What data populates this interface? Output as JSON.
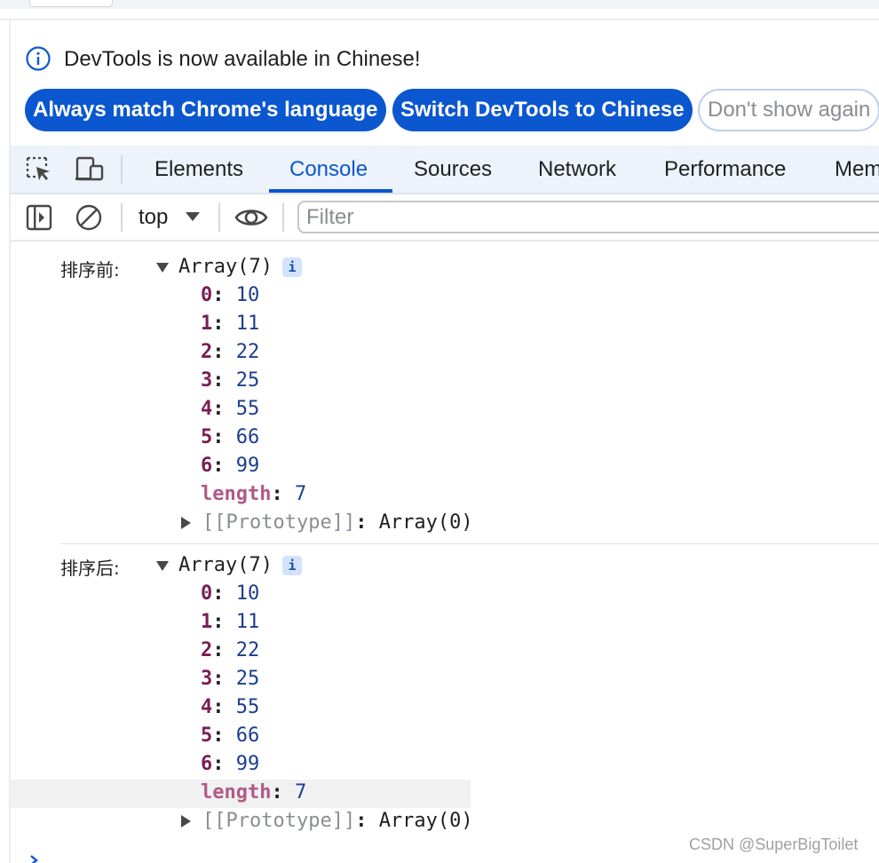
{
  "infobar": {
    "message": "DevTools is now available in Chinese!",
    "buttons": [
      "Always match Chrome's language",
      "Switch DevTools to Chinese",
      "Don't show again"
    ]
  },
  "tabs": [
    "Elements",
    "Console",
    "Sources",
    "Network",
    "Performance",
    "Mem"
  ],
  "active_tab": "Console",
  "console_toolbar": {
    "context": "top",
    "filter_placeholder": "Filter"
  },
  "messages": [
    {
      "label": "排序前:",
      "header": "Array(7)",
      "info_badge": "i",
      "entries": [
        {
          "key": "0",
          "value": "10"
        },
        {
          "key": "1",
          "value": "11"
        },
        {
          "key": "2",
          "value": "22"
        },
        {
          "key": "3",
          "value": "25"
        },
        {
          "key": "4",
          "value": "55"
        },
        {
          "key": "5",
          "value": "66"
        },
        {
          "key": "6",
          "value": "99"
        }
      ],
      "length_key": "length",
      "length_value": "7",
      "prototype_key": "[[Prototype]]",
      "prototype_value": "Array(0)"
    },
    {
      "label": "排序后:",
      "header": "Array(7)",
      "info_badge": "i",
      "entries": [
        {
          "key": "0",
          "value": "10"
        },
        {
          "key": "1",
          "value": "11"
        },
        {
          "key": "2",
          "value": "22"
        },
        {
          "key": "3",
          "value": "25"
        },
        {
          "key": "4",
          "value": "55"
        },
        {
          "key": "5",
          "value": "66"
        },
        {
          "key": "6",
          "value": "99"
        }
      ],
      "length_key": "length",
      "length_value": "7",
      "prototype_key": "[[Prototype]]",
      "prototype_value": "Array(0)"
    }
  ],
  "watermark": "CSDN @SuperBigToilet",
  "colors": {
    "accent": "#0b57d0",
    "object_key": "#7a1d54",
    "number_value": "#1c3e8f",
    "length_key": "#b05a86"
  }
}
